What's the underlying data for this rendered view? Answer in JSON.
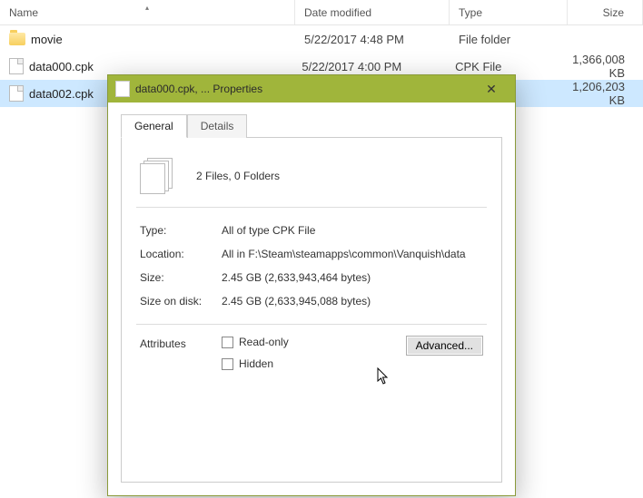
{
  "headers": {
    "name": "Name",
    "date": "Date modified",
    "type": "Type",
    "size": "Size"
  },
  "rows": [
    {
      "name": "movie",
      "date": "5/22/2017 4:48 PM",
      "type": "File folder",
      "size": "",
      "icon": "folder"
    },
    {
      "name": "data000.cpk",
      "date": "5/22/2017 4:00 PM",
      "type": "CPK File",
      "size": "1,366,008 KB",
      "icon": "file"
    },
    {
      "name": "data002.cpk",
      "date": "",
      "type": "",
      "size": "1,206,203 KB",
      "icon": "file",
      "selected": true
    }
  ],
  "dialog": {
    "title": "data000.cpk, ... Properties",
    "tabs": {
      "general": "General",
      "details": "Details"
    },
    "summary": "2 Files, 0 Folders",
    "info": {
      "type_label": "Type:",
      "type_value": "All of type CPK File",
      "location_label": "Location:",
      "location_value": "All in F:\\Steam\\steamapps\\common\\Vanquish\\data",
      "size_label": "Size:",
      "size_value": "2.45 GB (2,633,943,464 bytes)",
      "diskSize_label": "Size on disk:",
      "diskSize_value": "2.45 GB (2,633,945,088 bytes)"
    },
    "attributes": {
      "label": "Attributes",
      "readonly": "Read-only",
      "hidden": "Hidden",
      "advanced": "Advanced..."
    }
  }
}
